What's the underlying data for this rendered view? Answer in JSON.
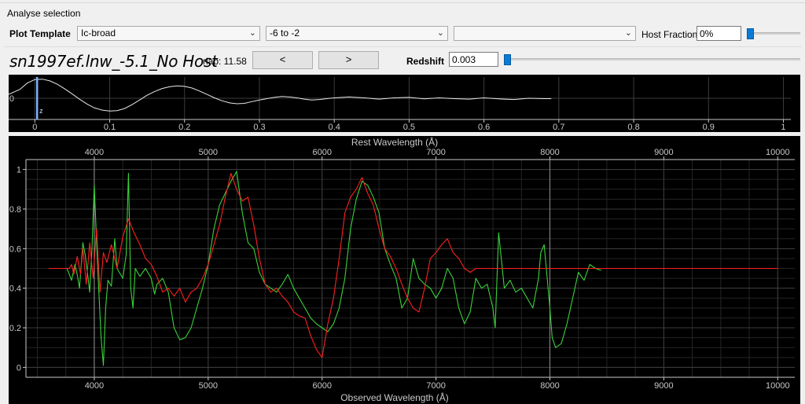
{
  "group": {
    "title": "Analyse selection"
  },
  "template": {
    "label": "Plot Template",
    "type_value": "Ic-broad",
    "age_value": "-6 to -2",
    "third_value": ""
  },
  "host": {
    "label": "Host Fraction",
    "value": "0%",
    "slider_fraction": 0.0
  },
  "selection": {
    "name": "sn1997ef.lnw_-5.1_No Host",
    "rlap_text": "rlap: 11.58",
    "prev_label": "<",
    "next_label": ">"
  },
  "redshift": {
    "label": "Redshift",
    "value": "0.003",
    "slider_fraction": 0.0
  },
  "colors": {
    "template": "#ff2020",
    "input": "#39d239",
    "axis": "#c8c8c8",
    "grid": "#3c3c3c"
  },
  "chart_data": [
    {
      "type": "line",
      "x_ticks": [
        0,
        0.1,
        0.2,
        0.3,
        0.4,
        0.5,
        0.6,
        0.7,
        0.8,
        0.9,
        1
      ],
      "y_ticks": [
        0
      ],
      "xlim": [
        -0.035,
        1.01
      ],
      "ylim": [
        -1,
        1
      ],
      "marker": {
        "x": 0.003,
        "label": "z"
      },
      "grid": true,
      "series": [
        {
          "x": [
            -0.035,
            -0.02,
            -0.01,
            0,
            0.01,
            0.02,
            0.03,
            0.04,
            0.05,
            0.06,
            0.07,
            0.08,
            0.09,
            0.1,
            0.11,
            0.12,
            0.13,
            0.14,
            0.15,
            0.16,
            0.17,
            0.18,
            0.19,
            0.2,
            0.21,
            0.22,
            0.23,
            0.24,
            0.25,
            0.26,
            0.27,
            0.28,
            0.29,
            0.3,
            0.31,
            0.32,
            0.33,
            0.34,
            0.35,
            0.36,
            0.37,
            0.38,
            0.39,
            0.4,
            0.42,
            0.44,
            0.46,
            0.48,
            0.5,
            0.52,
            0.54,
            0.56,
            0.58,
            0.6,
            0.62,
            0.64,
            0.66,
            0.68,
            0.69
          ],
          "y": [
            0.18,
            0.42,
            0.72,
            0.88,
            0.9,
            0.82,
            0.66,
            0.44,
            0.2,
            -0.05,
            -0.28,
            -0.46,
            -0.56,
            -0.6,
            -0.58,
            -0.48,
            -0.3,
            -0.08,
            0.14,
            0.32,
            0.46,
            0.54,
            0.58,
            0.56,
            0.48,
            0.34,
            0.18,
            0.02,
            -0.12,
            -0.22,
            -0.26,
            -0.24,
            -0.16,
            -0.08,
            -0.02,
            0.04,
            0.08,
            0.06,
            0.02,
            -0.04,
            -0.08,
            -0.06,
            -0.02,
            0.02,
            0.06,
            0.02,
            -0.04,
            0.02,
            0.04,
            -0.03,
            0.02,
            -0.02,
            -0.04,
            0.02,
            -0.03,
            -0.06,
            0.0,
            -0.02,
            -0.02
          ]
        }
      ]
    },
    {
      "type": "line",
      "xlabel": "Observed Wavelength (Å)",
      "x2label": "Rest Wavelength (Å)",
      "xlim": [
        3400,
        10150
      ],
      "ylim": [
        -0.05,
        1.05
      ],
      "x_ticks": [
        4000,
        5000,
        6000,
        7000,
        8000,
        9000,
        10000
      ],
      "y_ticks": [
        0,
        0.2,
        0.4,
        0.6,
        0.8,
        1
      ],
      "grid": true,
      "series": [
        {
          "name": "template",
          "color": "#ff2020",
          "x": [
            3600,
            3780,
            3800,
            3820,
            3850,
            3880,
            3900,
            3930,
            3960,
            3990,
            4020,
            4050,
            4080,
            4110,
            4150,
            4200,
            4250,
            4300,
            4350,
            4400,
            4450,
            4500,
            4550,
            4600,
            4650,
            4700,
            4750,
            4800,
            4850,
            4900,
            4950,
            5000,
            5050,
            5100,
            5150,
            5200,
            5250,
            5300,
            5350,
            5400,
            5450,
            5500,
            5550,
            5600,
            5650,
            5700,
            5750,
            5800,
            5850,
            5900,
            5950,
            6000,
            6050,
            6100,
            6150,
            6200,
            6250,
            6300,
            6350,
            6400,
            6450,
            6500,
            6550,
            6600,
            6650,
            6700,
            6750,
            6800,
            6850,
            6900,
            6950,
            7000,
            7050,
            7100,
            7150,
            7200,
            7250,
            7300,
            7350,
            7400,
            7450,
            7500,
            7550,
            7600,
            8200,
            10000
          ],
          "y": [
            0.5,
            0.5,
            0.52,
            0.47,
            0.56,
            0.47,
            0.6,
            0.42,
            0.63,
            0.45,
            0.7,
            0.38,
            0.58,
            0.53,
            0.62,
            0.5,
            0.66,
            0.75,
            0.68,
            0.62,
            0.55,
            0.52,
            0.46,
            0.38,
            0.4,
            0.36,
            0.4,
            0.33,
            0.38,
            0.4,
            0.45,
            0.52,
            0.62,
            0.72,
            0.86,
            0.98,
            0.9,
            0.84,
            0.86,
            0.72,
            0.55,
            0.42,
            0.38,
            0.4,
            0.36,
            0.33,
            0.28,
            0.26,
            0.25,
            0.16,
            0.09,
            0.05,
            0.22,
            0.35,
            0.55,
            0.78,
            0.86,
            0.9,
            0.96,
            0.88,
            0.82,
            0.7,
            0.6,
            0.56,
            0.5,
            0.42,
            0.35,
            0.3,
            0.28,
            0.4,
            0.55,
            0.58,
            0.62,
            0.65,
            0.58,
            0.55,
            0.5,
            0.48,
            0.5,
            0.5,
            0.5,
            0.5,
            0.5,
            0.5,
            0.5,
            0.5
          ]
        },
        {
          "name": "input",
          "color": "#39d239",
          "x": [
            3700,
            3760,
            3800,
            3830,
            3850,
            3870,
            3900,
            3920,
            3940,
            3960,
            3980,
            4000,
            4030,
            4060,
            4080,
            4100,
            4120,
            4150,
            4180,
            4200,
            4250,
            4280,
            4300,
            4320,
            4340,
            4360,
            4400,
            4450,
            4500,
            4530,
            4550,
            4600,
            4650,
            4700,
            4750,
            4800,
            4850,
            4900,
            4950,
            5000,
            5050,
            5100,
            5150,
            5200,
            5250,
            5300,
            5350,
            5400,
            5450,
            5500,
            5550,
            5600,
            5650,
            5700,
            5750,
            5800,
            5850,
            5900,
            5950,
            6000,
            6050,
            6100,
            6150,
            6200,
            6250,
            6300,
            6350,
            6400,
            6450,
            6500,
            6550,
            6600,
            6650,
            6700,
            6750,
            6800,
            6850,
            6900,
            6950,
            7000,
            7050,
            7100,
            7150,
            7200,
            7250,
            7300,
            7350,
            7400,
            7450,
            7500,
            7520,
            7550,
            7600,
            7650,
            7700,
            7750,
            7800,
            7850,
            7900,
            7920,
            7950,
            8000,
            8020,
            8050,
            8100,
            8150,
            8200,
            8250,
            8300,
            8350,
            8400,
            8450
          ],
          "y": [
            0.5,
            0.5,
            0.44,
            0.52,
            0.47,
            0.4,
            0.63,
            0.57,
            0.48,
            0.38,
            0.6,
            0.92,
            0.5,
            0.15,
            0.01,
            0.3,
            0.44,
            0.41,
            0.65,
            0.5,
            0.45,
            0.57,
            0.98,
            0.4,
            0.3,
            0.5,
            0.46,
            0.5,
            0.45,
            0.37,
            0.42,
            0.45,
            0.38,
            0.2,
            0.14,
            0.15,
            0.2,
            0.3,
            0.4,
            0.52,
            0.7,
            0.82,
            0.88,
            0.94,
            0.99,
            0.78,
            0.63,
            0.6,
            0.48,
            0.42,
            0.4,
            0.38,
            0.42,
            0.47,
            0.4,
            0.35,
            0.3,
            0.25,
            0.22,
            0.2,
            0.18,
            0.22,
            0.3,
            0.45,
            0.7,
            0.85,
            0.94,
            0.92,
            0.86,
            0.78,
            0.6,
            0.52,
            0.45,
            0.3,
            0.35,
            0.55,
            0.45,
            0.42,
            0.4,
            0.35,
            0.4,
            0.5,
            0.45,
            0.3,
            0.22,
            0.28,
            0.45,
            0.4,
            0.42,
            0.3,
            0.2,
            0.68,
            0.4,
            0.44,
            0.38,
            0.4,
            0.35,
            0.3,
            0.45,
            0.58,
            0.62,
            0.3,
            0.15,
            0.1,
            0.12,
            0.22,
            0.35,
            0.48,
            0.44,
            0.52,
            0.5,
            0.49
          ]
        }
      ]
    }
  ]
}
